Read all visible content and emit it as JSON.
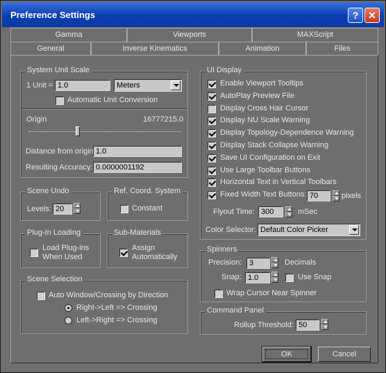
{
  "window": {
    "title": "Preference Settings"
  },
  "tabs_row1": [
    "Gamma",
    "Viewports",
    "MAXScript"
  ],
  "tabs_row2": [
    "General",
    "Inverse Kinematics",
    "Animation",
    "Files"
  ],
  "system_unit": {
    "legend": "System Unit Scale",
    "unit_label": "1 Unit =",
    "unit_value": "1.0",
    "unit_type": "Meters",
    "auto_conversion_label": "Automatic Unit Conversion",
    "origin_label": "Origin",
    "origin_value": "16777215.0",
    "distance_label": "Distance from origin:",
    "distance_value": "1.0",
    "accuracy_label": "Resulting Accuracy:",
    "accuracy_value": "0.0000001192"
  },
  "scene_undo": {
    "legend": "Scene Undo",
    "levels_label": "Levels:",
    "levels_value": "20"
  },
  "ref_coord": {
    "legend": "Ref. Coord. System",
    "constant_label": "Constant"
  },
  "plugin_loading": {
    "legend": "Plug-In Loading",
    "load_label_1": "Load Plug-ins",
    "load_label_2": "When Used"
  },
  "sub_materials": {
    "legend": "Sub-Materials",
    "assign_label_1": "Assign",
    "assign_label_2": "Automatically"
  },
  "scene_selection": {
    "legend": "Scene Selection",
    "auto_window_label": "Auto Window/Crossing by Direction",
    "rl_label": "Right->Left => Crossing",
    "lr_label": "Left->Right => Crossing"
  },
  "ui_display": {
    "legend": "UI Display",
    "items": [
      {
        "label": "Enable Viewport Tooltips",
        "checked": true
      },
      {
        "label": "AutoPlay Preview File",
        "checked": true
      },
      {
        "label": "Display Cross Hair Cursor",
        "checked": false
      },
      {
        "label": "Display NU Scale Warning",
        "checked": true
      },
      {
        "label": "Display Topology-Dependence Warning",
        "checked": true
      },
      {
        "label": "Display Stack Collapse Warning",
        "checked": true
      },
      {
        "label": "Save UI Configuration on Exit",
        "checked": true
      },
      {
        "label": "Use Large Toolbar Buttons",
        "checked": true
      },
      {
        "label": "Horizontal Text in Vertical Toolbars",
        "checked": true
      },
      {
        "label": "Fixed Width Text Buttons:",
        "checked": true
      }
    ],
    "fixed_width_value": "70",
    "pixels_label": "pixels",
    "flyout_label": "Flyout Time:",
    "flyout_value": "300",
    "msec_label": "mSec",
    "color_selector_label": "Color Selector:",
    "color_selector_value": "Default Color Picker"
  },
  "spinners": {
    "legend": "Spinners",
    "precision_label": "Precision:",
    "precision_value": "3",
    "decimals_label": "Decimals",
    "snap_label": "Snap:",
    "snap_value": "1.0",
    "use_snap_label": "Use Snap",
    "wrap_label": "Wrap Cursor Near Spinner"
  },
  "command_panel": {
    "legend": "Command Panel",
    "rollup_label": "Rollup Threshold:",
    "rollup_value": "50"
  },
  "buttons": {
    "ok": "OK",
    "cancel": "Cancel"
  }
}
